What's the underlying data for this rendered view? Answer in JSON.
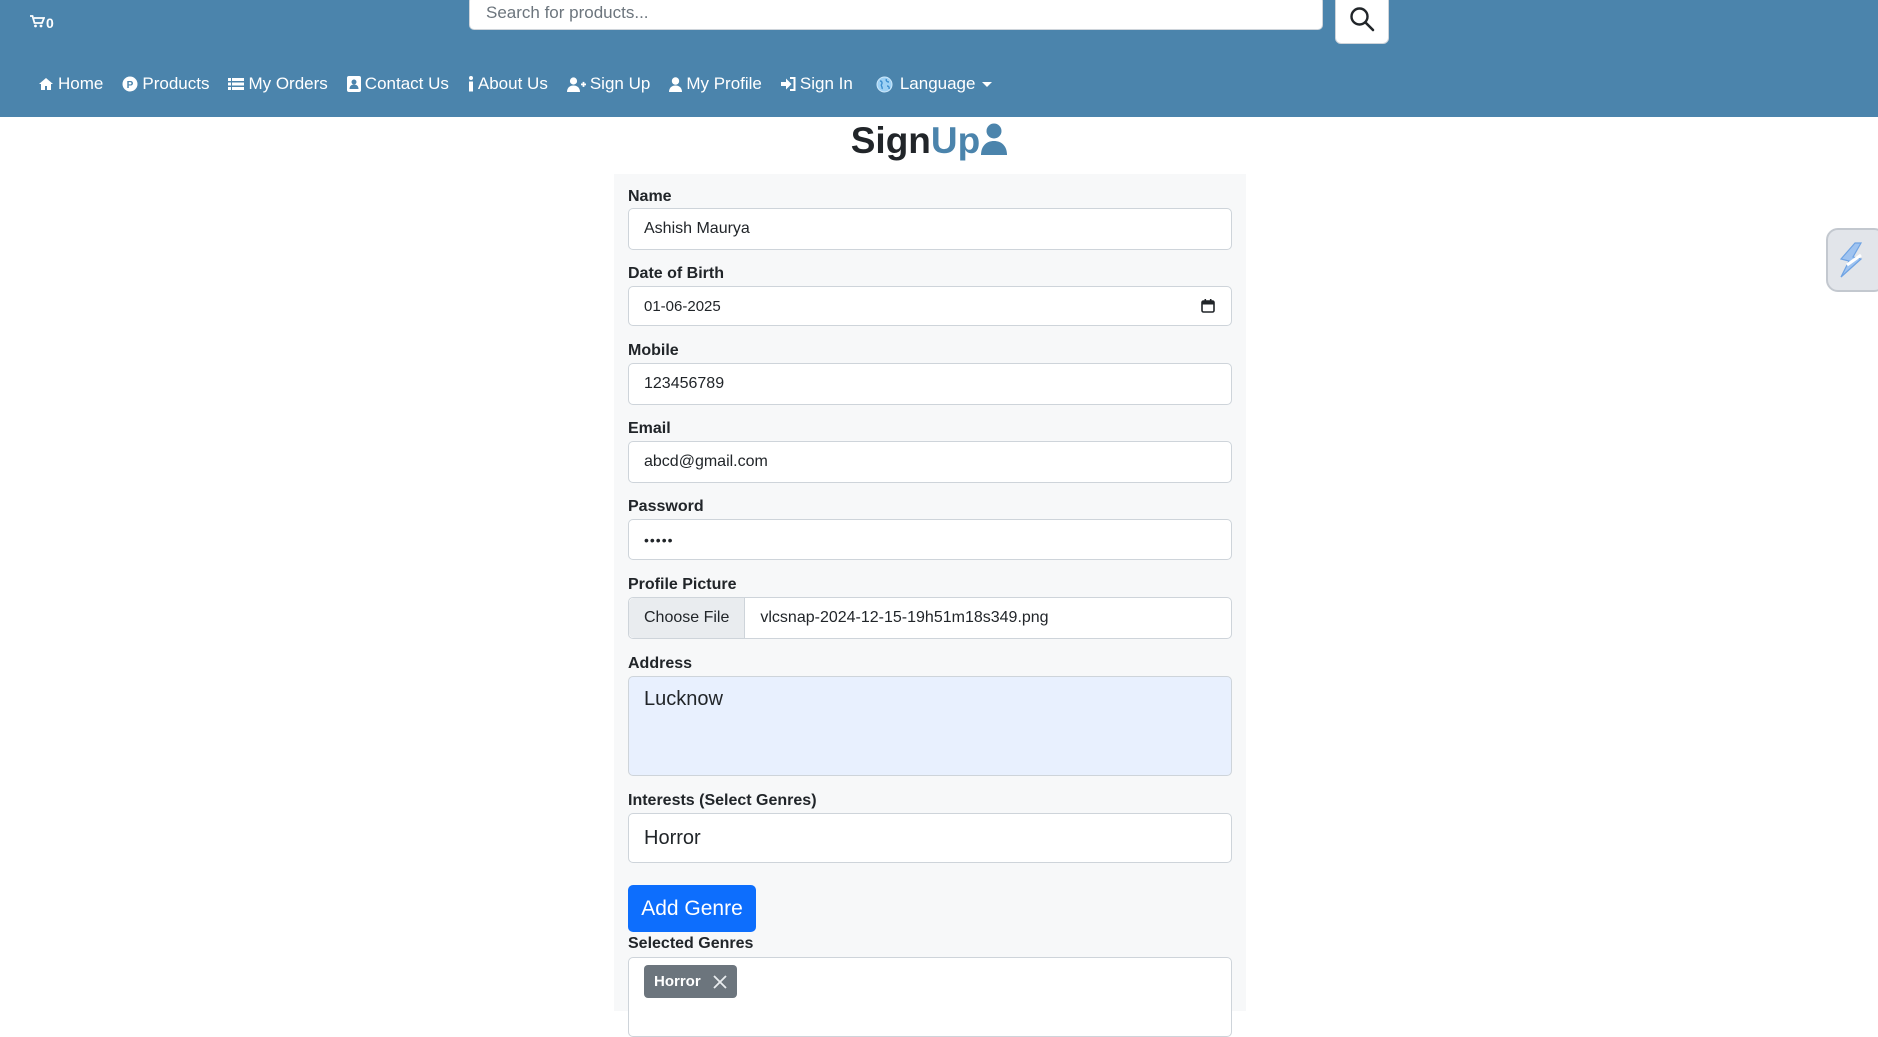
{
  "header": {
    "cart_count": "0",
    "search_placeholder": "Search for products...",
    "nav": [
      {
        "label": "Home",
        "icon": "home-icon"
      },
      {
        "label": "Products",
        "icon": "products-icon"
      },
      {
        "label": "My Orders",
        "icon": "list-icon"
      },
      {
        "label": "Contact Us",
        "icon": "contact-card-icon"
      },
      {
        "label": "About Us",
        "icon": "info-icon"
      },
      {
        "label": "Sign Up",
        "icon": "user-plus-icon"
      },
      {
        "label": "My Profile",
        "icon": "user-icon"
      },
      {
        "label": "Sign In",
        "icon": "sign-in-icon"
      },
      {
        "label": "Language",
        "icon": "globe-icon"
      }
    ]
  },
  "page": {
    "title_part1": "Sign",
    "title_part2": "Up"
  },
  "form": {
    "name_label": "Name",
    "name_value": "Ashish Maurya",
    "dob_label": "Date of Birth",
    "dob_value": "01-06-2025",
    "mobile_label": "Mobile",
    "mobile_value": "123456789",
    "email_label": "Email",
    "email_value": "abcd@gmail.com",
    "password_label": "Password",
    "password_value": "•••••",
    "picture_label": "Profile Picture",
    "choose_file_label": "Choose File",
    "file_name": "vlcsnap-2024-12-15-19h51m18s349.png",
    "address_label": "Address",
    "address_value": "Lucknow",
    "interests_label": "Interests (Select Genres)",
    "interests_value": "Horror",
    "add_genre_label": "Add Genre",
    "selected_label": "Selected Genres",
    "selected_genres": [
      "Horror"
    ]
  },
  "colors": {
    "header_bg": "#4b84ac",
    "primary_button": "#0d6efd",
    "tag_bg": "#6c757d"
  }
}
